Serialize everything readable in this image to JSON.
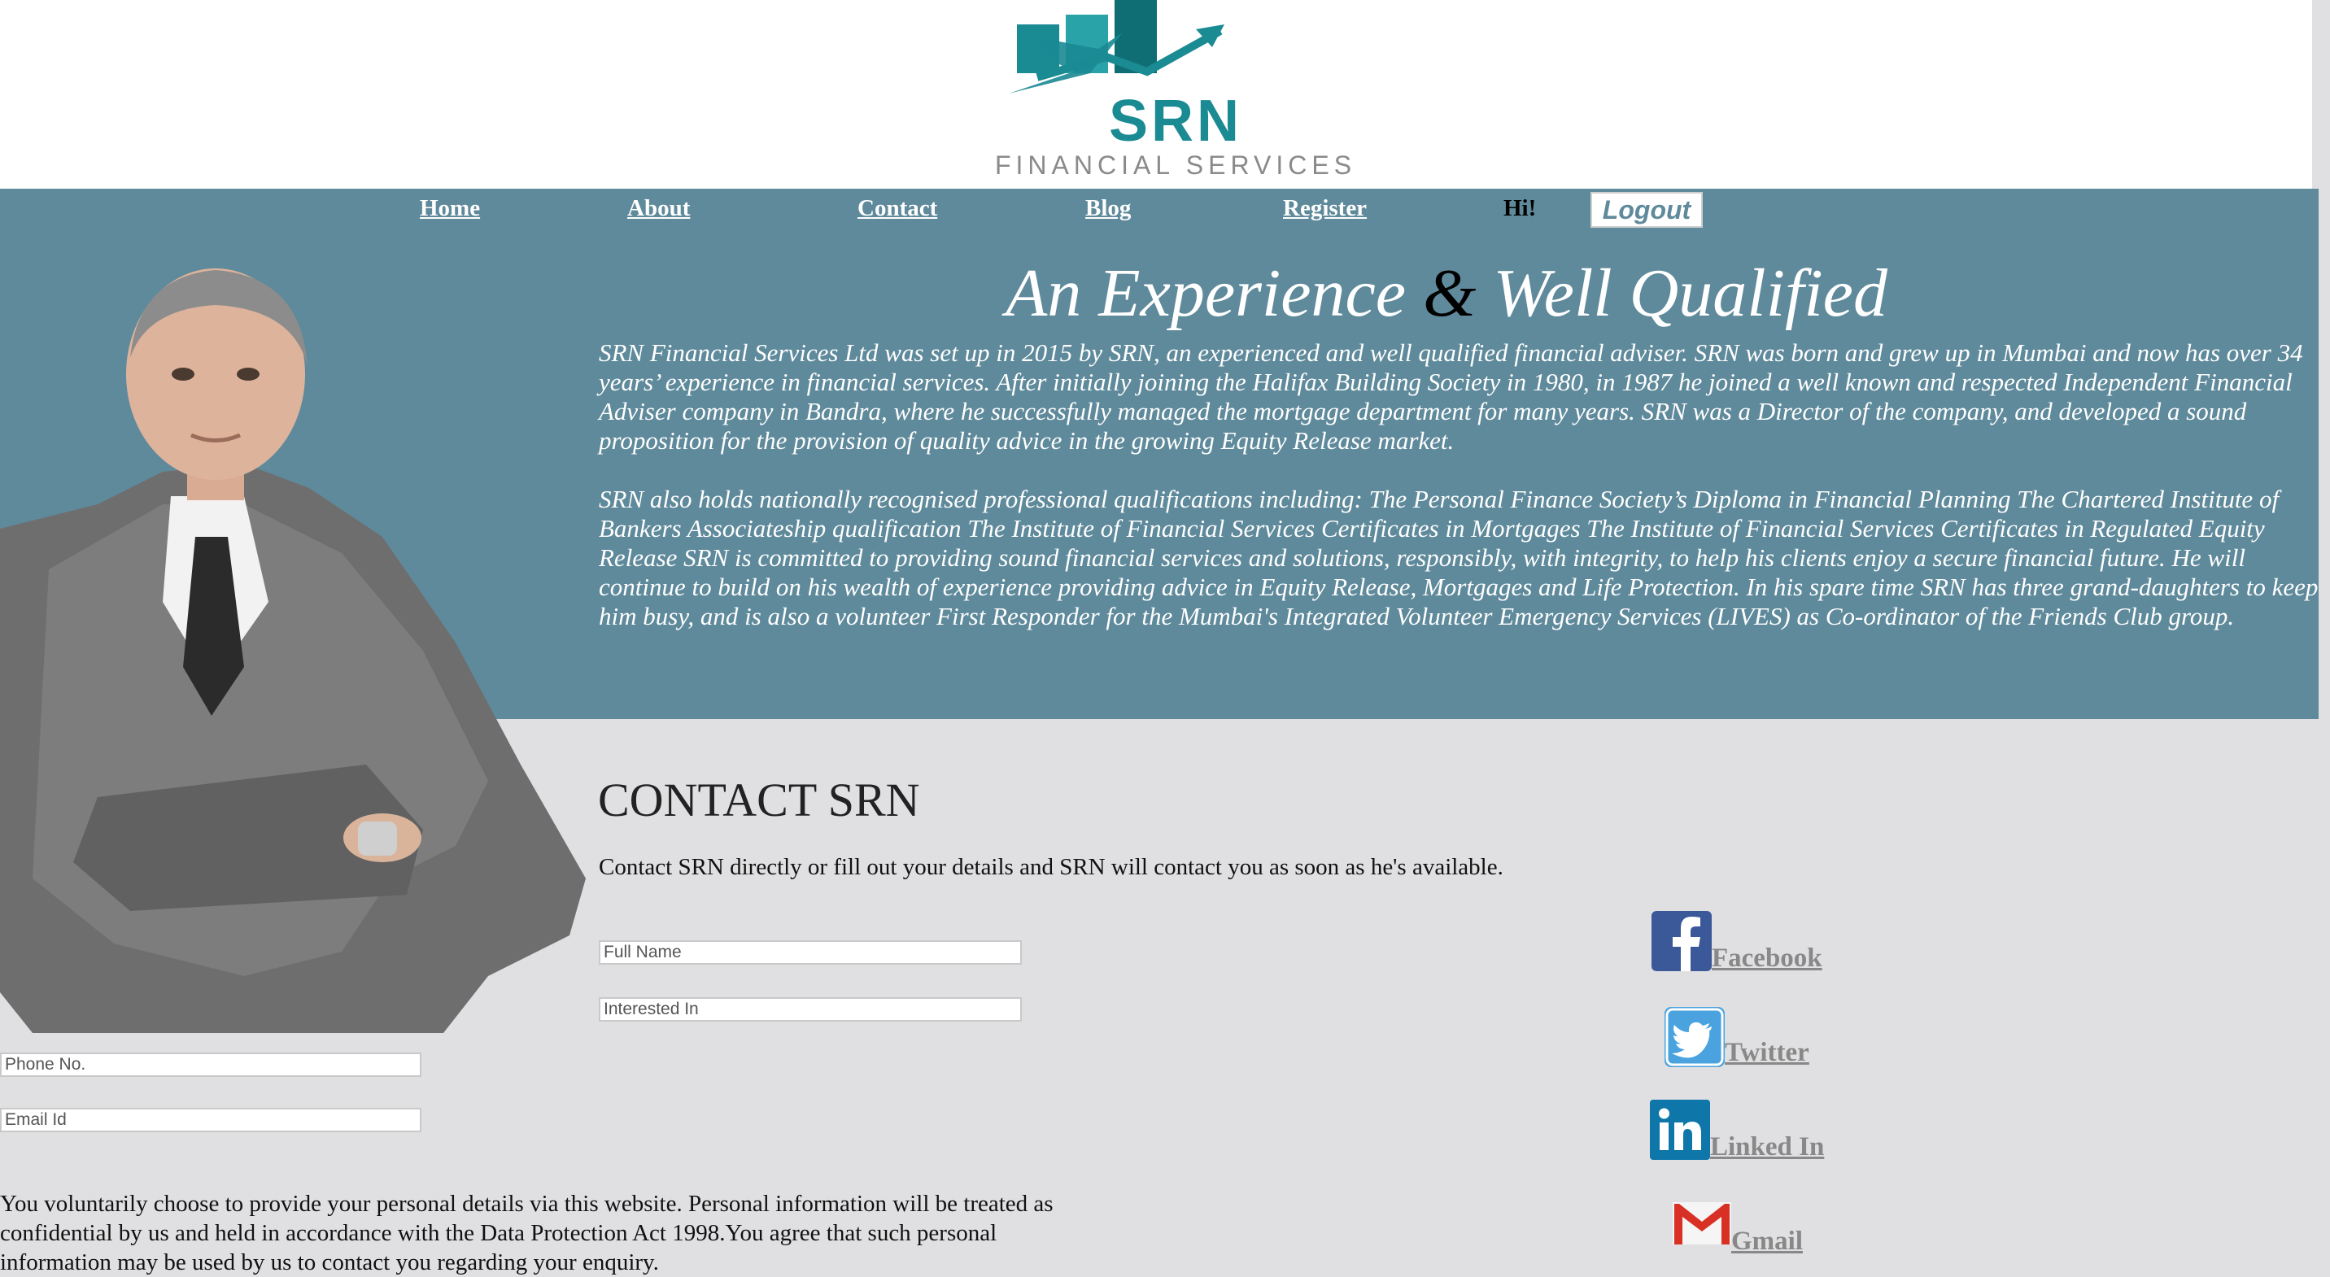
{
  "brand": {
    "name": "SRN",
    "tagline": "FINANCIAL SERVICES",
    "colors": {
      "teal": "#1a8a93",
      "band": "#5f8a9b",
      "content_bg": "#e0dfe1"
    }
  },
  "nav": {
    "items": [
      "Home",
      "About",
      "Contact",
      "Blog",
      "Register"
    ],
    "greeting": "Hi!",
    "logout_label": "Logout"
  },
  "hero": {
    "headline_part1": "An Experience ",
    "headline_amp": "&",
    "headline_part2": " Well Qualified",
    "paragraphs": [
      "SRN Financial Services Ltd was set up in 2015 by SRN, an experienced and well qualified financial adviser. SRN was born and grew up in Mumbai and now has over 34 years’ experience in financial services. After initially joining the Halifax Building Society in 1980, in 1987 he joined a well known and respected Independent Financial Adviser company in Bandra, where he successfully managed the mortgage department for many years. SRN was a Director of the company, and developed a sound proposition for the provision of quality advice in the growing Equity Release market.",
      "SRN also holds nationally recognised professional qualifications including: The Personal Finance Society’s Diploma in Financial Planning The Chartered Institute of Bankers Associateship qualification The Institute of Financial Services Certificates in Mortgages The Institute of Financial Services Certificates in Regulated Equity Release SRN is committed to providing sound financial services and solutions, responsibly, with integrity, to help his clients enjoy a secure financial future. He will continue to build on his wealth of experience providing advice in Equity Release, Mortgages and Life Protection. In his spare time SRN has three grand-daughters to keep him busy, and is also a volunteer First Responder for the Mumbai's Integrated Volunteer Emergency Services (LIVES) as Co-ordinator of the Friends Club group."
    ]
  },
  "contact": {
    "title": "CONTACT SRN",
    "subtitle": "Contact SRN directly or fill out your details and SRN will contact you as soon as he's available.",
    "fields": {
      "full_name": {
        "placeholder": "Full Name",
        "value": ""
      },
      "interested_in": {
        "placeholder": "Interested In",
        "value": ""
      },
      "phone": {
        "placeholder": "Phone No.",
        "value": ""
      },
      "email": {
        "placeholder": "Email Id",
        "value": ""
      }
    },
    "disclaimer": "You voluntarily choose to provide your personal details via this website. Personal information will be treated as confidential by us and held in accordance with the Data Protection Act 1998.You agree that such personal information may be used by us to contact you regarding your enquiry."
  },
  "social": [
    {
      "label": "Facebook",
      "icon": "facebook-icon",
      "color": "#3b5998"
    },
    {
      "label": "Twitter",
      "icon": "twitter-icon",
      "color": "#4aa3df"
    },
    {
      "label": "Linked In",
      "icon": "linkedin-icon",
      "color": "#0e76a8"
    },
    {
      "label": "Gmail",
      "icon": "gmail-icon",
      "color": "#d93025"
    }
  ]
}
